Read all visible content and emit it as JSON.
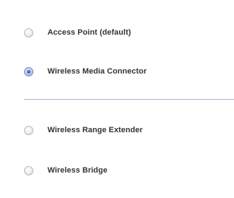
{
  "mode_options": [
    {
      "label": "Access Point (default)",
      "selected": false
    },
    {
      "label": "Wireless Media Connector",
      "selected": true
    },
    {
      "label": "Wireless Range Extender",
      "selected": false
    },
    {
      "label": "Wireless Bridge",
      "selected": false
    }
  ]
}
